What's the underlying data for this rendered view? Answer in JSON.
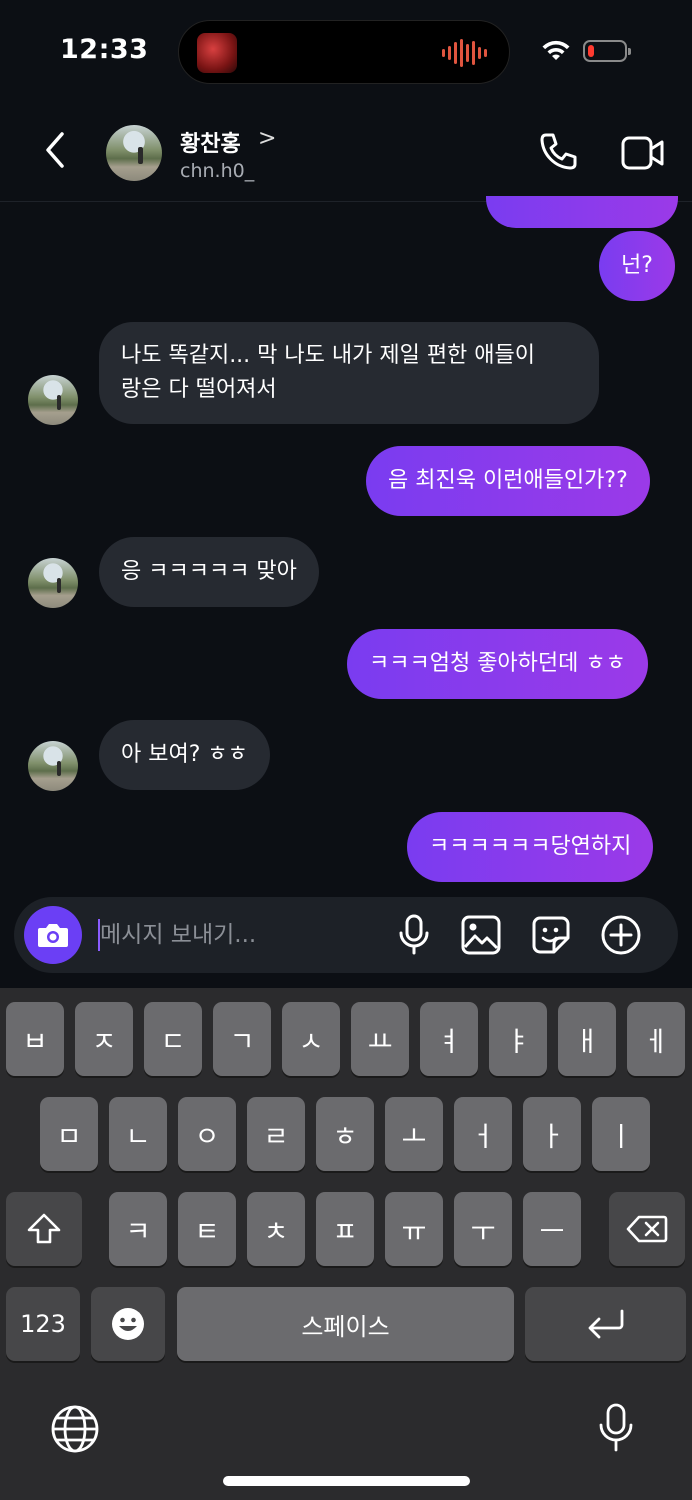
{
  "status": {
    "time": "12:33",
    "battery_color": "#ff3b30"
  },
  "header": {
    "name": "황찬홍",
    "chevron": ">",
    "handle": "chn.h0_"
  },
  "messages": [
    {
      "side": "out",
      "text": ""
    },
    {
      "side": "out",
      "text": "넌?"
    },
    {
      "side": "in",
      "lines": [
        "나도 똑같지... 막 나도 내가 제일 편한 애들이",
        "랑은 다 떨어져서"
      ]
    },
    {
      "side": "out",
      "text": "음 최진욱 이런애들인가??"
    },
    {
      "side": "in",
      "text": "응 ㅋㅋㅋㅋㅋ 맞아"
    },
    {
      "side": "out",
      "text": "ㅋㅋㅋ엄청 좋아하던데 ㅎㅎ"
    },
    {
      "side": "in",
      "text": "아 보여? ㅎㅎ"
    },
    {
      "side": "out",
      "text": "ㅋㅋㅋㅋㅋㅋ당연하지"
    }
  ],
  "composer": {
    "placeholder": "메시지 보내기..."
  },
  "keyboard": {
    "row1": [
      "ㅂ",
      "ㅈ",
      "ㄷ",
      "ㄱ",
      "ㅅ",
      "ㅛ",
      "ㅕ",
      "ㅑ",
      "ㅐ",
      "ㅔ"
    ],
    "row2": [
      "ㅁ",
      "ㄴ",
      "ㅇ",
      "ㄹ",
      "ㅎ",
      "ㅗ",
      "ㅓ",
      "ㅏ",
      "ㅣ"
    ],
    "row3": [
      "ㅋ",
      "ㅌ",
      "ㅊ",
      "ㅍ",
      "ㅠ",
      "ㅜ",
      "ㅡ"
    ],
    "numbers_label": "123",
    "space_label": "스페이스"
  },
  "colors": {
    "accent": "#6b3ff5",
    "outgoing": "#8a3cf0",
    "incoming": "#262a31"
  }
}
